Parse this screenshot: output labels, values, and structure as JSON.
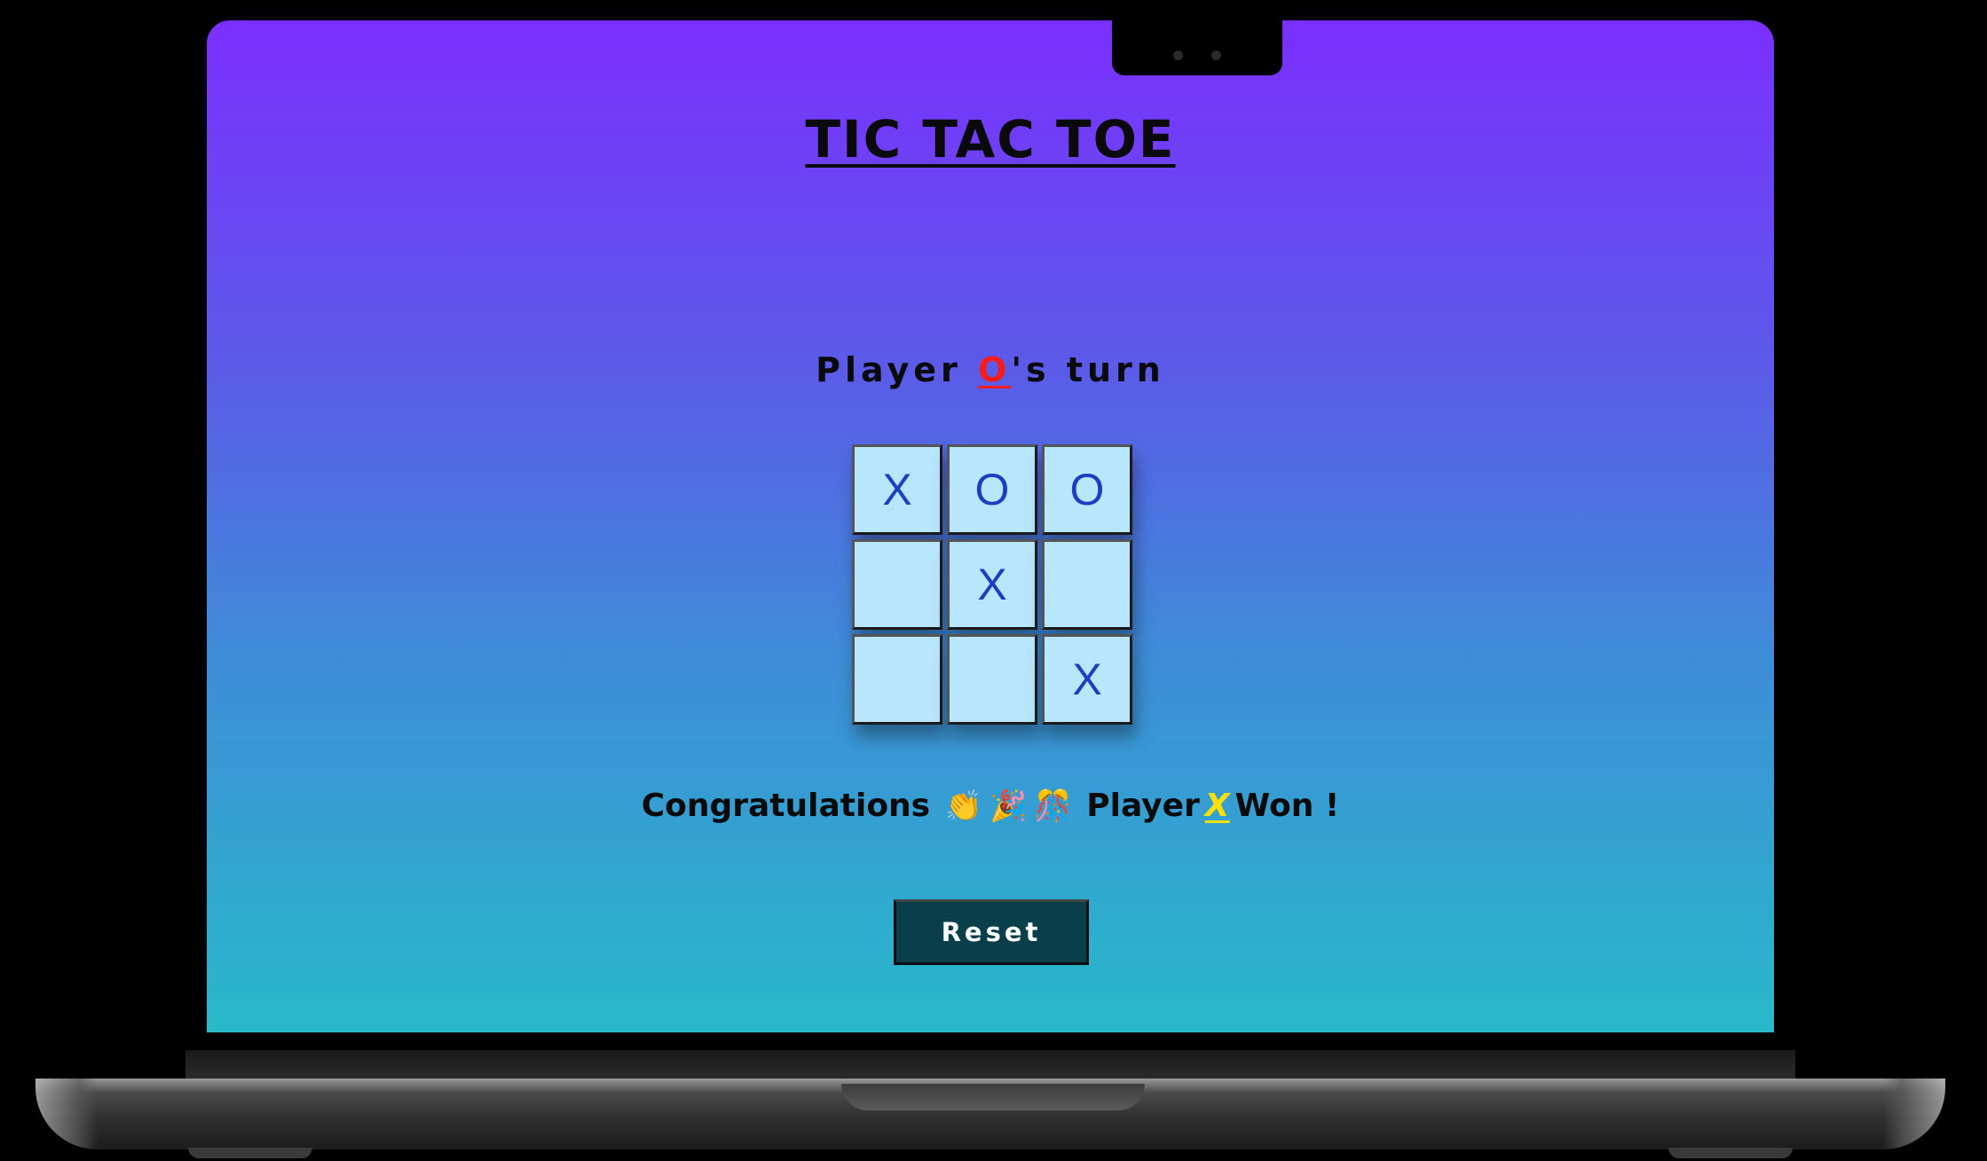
{
  "game": {
    "title": "TIC TAC TOE",
    "turn_prefix": "Player ",
    "turn_player": "O",
    "turn_suffix": "'s turn",
    "board": {
      "cells": [
        "X",
        "O",
        "O",
        "",
        "X",
        "",
        "",
        "",
        "X"
      ]
    },
    "winner_message": {
      "prefix": "Congratulations",
      "emojis": [
        "👏",
        "🎉",
        "🎊"
      ],
      "player_label": "Player",
      "winner": "X",
      "suffix": "Won !"
    },
    "reset_label": "Reset"
  },
  "colors": {
    "gradient_top": "#7b2ffe",
    "gradient_bottom": "#28b9ca",
    "cell_bg": "#b8e6fd",
    "mark_color": "#1b3ec4",
    "turn_player_color": "#ff1a1a",
    "winner_color": "#ffe100",
    "reset_bg": "#083f4a"
  }
}
